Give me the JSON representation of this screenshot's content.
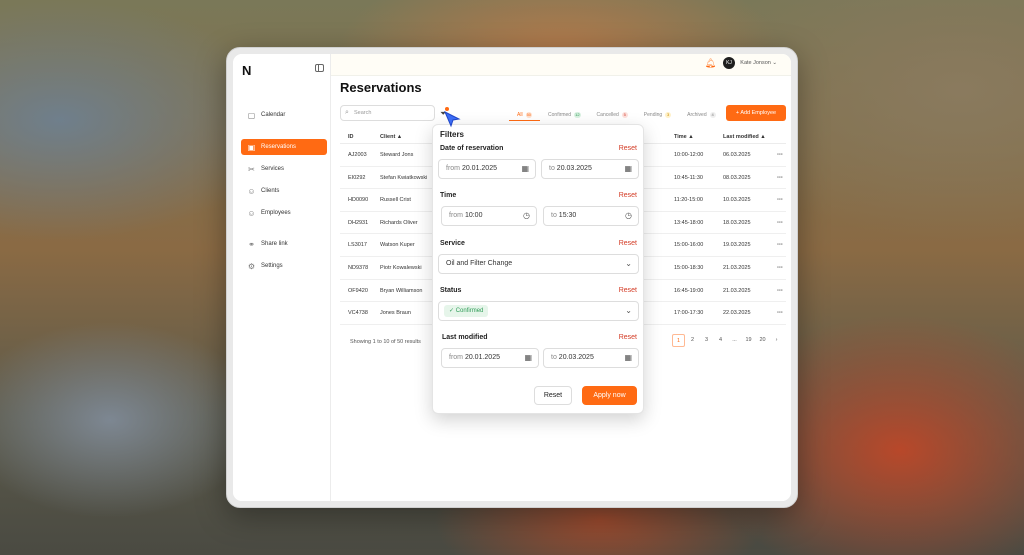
{
  "app": {
    "logo": "N",
    "user_initials": "KJ",
    "user_name": "Kate Jonson ⌄"
  },
  "nav": [
    {
      "label": "Calendar",
      "icon": "calendar-icon",
      "glyph": "▢"
    },
    {
      "label": "Reservations",
      "icon": "reservations-icon",
      "glyph": "▣",
      "active": true
    },
    {
      "label": "Services",
      "icon": "services-icon",
      "glyph": "✂"
    },
    {
      "label": "Clients",
      "icon": "clients-icon",
      "glyph": "☺"
    },
    {
      "label": "Employees",
      "icon": "employees-icon",
      "glyph": "☺"
    },
    {
      "label": "Share link",
      "icon": "link-icon",
      "glyph": "⚭"
    },
    {
      "label": "Settings",
      "icon": "settings-icon",
      "glyph": "⚙"
    }
  ],
  "page": {
    "title": "Reservations",
    "search_placeholder": "Search",
    "add_button": "+ Add Employee"
  },
  "tabs": [
    {
      "label": "All",
      "count": "50",
      "active": true
    },
    {
      "label": "Confirmed",
      "count": "12",
      "color": "green"
    },
    {
      "label": "Cancelled",
      "count": "5",
      "color": "red"
    },
    {
      "label": "Pending",
      "count": "3",
      "color": "yellow"
    },
    {
      "label": "Archived",
      "count": "4"
    }
  ],
  "table": {
    "headers": {
      "id": "ID",
      "client": "Client ▲",
      "time": "Time ▲",
      "modified": "Last modified ▲"
    },
    "rows": [
      {
        "id": "AJ2003",
        "client": "Steward Jons",
        "time": "10:00-12:00",
        "modified": "06.03.2025"
      },
      {
        "id": "EI0292",
        "client": "Stefan Kwiatkowski",
        "time": "10:45-11:30",
        "modified": "08.03.2025"
      },
      {
        "id": "HD0090",
        "client": "Russell Crist",
        "time": "11:20-15:00",
        "modified": "10.03.2025"
      },
      {
        "id": "DH2931",
        "client": "Richards Oliver",
        "time": "13:45-18:00",
        "modified": "18.03.2025"
      },
      {
        "id": "LS3017",
        "client": "Watson Kuper",
        "time": "15:00-16:00",
        "modified": "19.03.2025"
      },
      {
        "id": "ND9378",
        "client": "Piotr Kowalewski",
        "time": "15:00-18:30",
        "modified": "21.03.2025"
      },
      {
        "id": "OF9420",
        "client": "Bryan Williamson",
        "time": "16:45-19:00",
        "modified": "21.03.2025"
      },
      {
        "id": "VC4738",
        "client": "Jones Braun",
        "time": "17:00-17:30",
        "modified": "22.03.2025"
      }
    ],
    "results": "Showing 1 to 10 of 50 results",
    "pages": [
      "1",
      "2",
      "3",
      "4",
      "...",
      "19",
      "20",
      "›"
    ]
  },
  "filters": {
    "title": "Filters",
    "reset_label": "Reset",
    "date_label": "Date of reservation",
    "date_from_prefix": "from",
    "date_from": "20.01.2025",
    "date_to_prefix": "to",
    "date_to": "20.03.2025",
    "time_label": "Time",
    "time_from_prefix": "from",
    "time_from": "10:00",
    "time_to_prefix": "to",
    "time_to": "15:30",
    "service_label": "Service",
    "service_value": "Oil and Filter Change",
    "status_label": "Status",
    "status_value": "✓ Confirmed",
    "modified_label": "Last modified",
    "mod_from_prefix": "from",
    "mod_from": "20.01.2025",
    "mod_to_prefix": "to",
    "mod_to": "20.03.2025",
    "reset_button": "Reset",
    "apply_button": "Apply now"
  },
  "colors": {
    "accent": "#ff6a13",
    "reset_red": "#d33a24"
  }
}
